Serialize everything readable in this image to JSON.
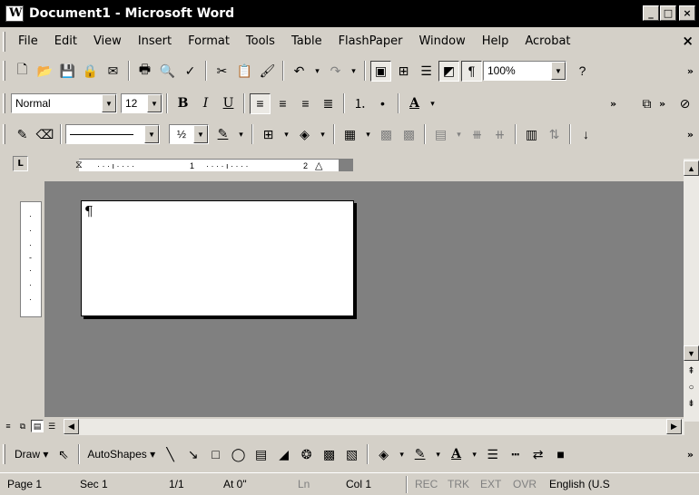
{
  "window": {
    "title": "Document1 - Microsoft Word",
    "minimize_glyph": "_",
    "maximize_glyph": "□",
    "close_glyph": "×"
  },
  "menubar": {
    "items": [
      "File",
      "Edit",
      "View",
      "Insert",
      "Format",
      "Tools",
      "Table",
      "FlashPaper",
      "Window",
      "Help",
      "Acrobat"
    ],
    "close_glyph": "×"
  },
  "standard_toolbar": {
    "zoom": "100%",
    "help_glyph": "?",
    "more_glyph": "»"
  },
  "formatting_toolbar": {
    "style": "Normal",
    "font_size": "12",
    "bold_label": "B",
    "italic_label": "I",
    "underline_label": "U",
    "font_color_label": "A",
    "more_glyph": "»"
  },
  "tables_toolbar": {
    "line_weight": "½",
    "more_glyph": "»"
  },
  "ruler": {
    "tab_selector": "L",
    "marks": [
      "1",
      "2"
    ]
  },
  "document": {
    "paragraph_mark": "¶"
  },
  "drawing_toolbar": {
    "draw_label": "Draw ▾",
    "autoshapes_label": "AutoShapes ▾",
    "more_glyph": "»"
  },
  "statusbar": {
    "page": "Page 1",
    "section": "Sec 1",
    "page_of": "1/1",
    "at": "At 0\"",
    "line": "Ln",
    "col": "Col 1",
    "rec": "REC",
    "trk": "TRK",
    "ext": "EXT",
    "ovr": "OVR",
    "language": "English (U.S"
  }
}
